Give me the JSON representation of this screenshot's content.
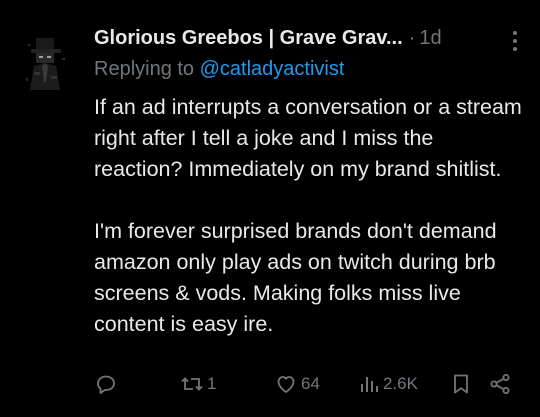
{
  "tweet": {
    "author_name": "Glorious Greebos | Grave Grav...",
    "separator": "·",
    "time": "1d",
    "replying_prefix": "Replying to ",
    "replying_handle": "@catladyactivist",
    "paragraphs": [
      "If an ad interrupts a conversation or a stream right after I tell a joke and I miss the reaction? Immediately on my brand shitlist.",
      "I'm forever surprised brands don't demand amazon only play ads on twitch during brb screens & vods. Making folks miss live content is easy ire."
    ]
  },
  "actions": {
    "reply_icon": "reply-icon",
    "retweet_icon": "retweet-icon",
    "retweet_count": "1",
    "like_icon": "heart-icon",
    "like_count": "64",
    "views_icon": "views-icon",
    "views_count": "2.6K",
    "bookmark_icon": "bookmark-icon",
    "share_icon": "share-icon"
  },
  "colors": {
    "background": "#000000",
    "text": "#e7e9ea",
    "muted": "#71767b",
    "link": "#1d9bf0"
  }
}
